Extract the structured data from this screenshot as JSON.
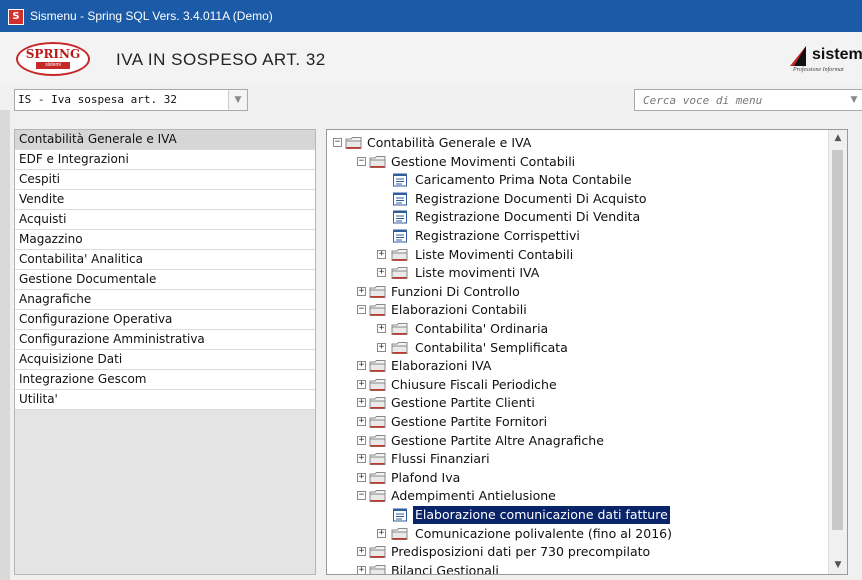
{
  "window": {
    "title": "Sismenu - Spring SQL Vers. 3.4.011A (Demo)",
    "icon_letter": "S"
  },
  "header": {
    "page_title": "IVA IN SOSPESO ART. 32",
    "spring_logo": {
      "text": "SPRING",
      "subtext": "sistemi"
    },
    "sistemi_logo": {
      "word": "sistem",
      "tagline": "Professione Informat"
    }
  },
  "menu_select": {
    "value": "IS - Iva sospesa art. 32"
  },
  "search": {
    "placeholder": "Cerca voce di menu"
  },
  "sidebar": {
    "items": [
      {
        "label": "Contabilità Generale e IVA",
        "active": true
      },
      {
        "label": "EDF e Integrazioni"
      },
      {
        "label": "Cespiti"
      },
      {
        "label": "Vendite"
      },
      {
        "label": "Acquisti"
      },
      {
        "label": "Magazzino"
      },
      {
        "label": "Contabilita' Analitica"
      },
      {
        "label": "Gestione Documentale"
      },
      {
        "label": "Anagrafiche"
      },
      {
        "label": "Configurazione Operativa"
      },
      {
        "label": "Configurazione Amministrativa"
      },
      {
        "label": "Acquisizione Dati"
      },
      {
        "label": "Integrazione Gescom"
      },
      {
        "label": "Utilita'"
      }
    ]
  },
  "tree": {
    "nodes": [
      {
        "label": "Contabilità Generale e IVA",
        "level": 0,
        "kind": "root",
        "exp": "−"
      },
      {
        "label": "Gestione Movimenti Contabili",
        "level": 1,
        "kind": "folder",
        "exp": "−"
      },
      {
        "label": "Caricamento Prima Nota Contabile",
        "level": 2,
        "kind": "doc"
      },
      {
        "label": "Registrazione Documenti Di Acquisto",
        "level": 2,
        "kind": "doc"
      },
      {
        "label": "Registrazione Documenti Di Vendita",
        "level": 2,
        "kind": "doc"
      },
      {
        "label": "Registrazione Corrispettivi",
        "level": 2,
        "kind": "doc"
      },
      {
        "label": "Liste Movimenti Contabili",
        "level": 2,
        "kind": "folder",
        "exp": "+"
      },
      {
        "label": "Liste movimenti IVA",
        "level": 2,
        "kind": "folder",
        "exp": "+"
      },
      {
        "label": "Funzioni Di Controllo",
        "level": 1,
        "kind": "folder",
        "exp": "+"
      },
      {
        "label": "Elaborazioni Contabili",
        "level": 1,
        "kind": "folder",
        "exp": "−"
      },
      {
        "label": "Contabilita' Ordinaria",
        "level": 2,
        "kind": "folder",
        "exp": "+"
      },
      {
        "label": "Contabilita' Semplificata",
        "level": 2,
        "kind": "folder",
        "exp": "+"
      },
      {
        "label": "Elaborazioni IVA",
        "level": 1,
        "kind": "folder",
        "exp": "+"
      },
      {
        "label": "Chiusure Fiscali Periodiche",
        "level": 1,
        "kind": "folder",
        "exp": "+"
      },
      {
        "label": "Gestione Partite Clienti",
        "level": 1,
        "kind": "folder",
        "exp": "+"
      },
      {
        "label": "Gestione Partite Fornitori",
        "level": 1,
        "kind": "folder",
        "exp": "+"
      },
      {
        "label": "Gestione Partite Altre Anagrafiche",
        "level": 1,
        "kind": "folder",
        "exp": "+"
      },
      {
        "label": "Flussi Finanziari",
        "level": 1,
        "kind": "folder",
        "exp": "+"
      },
      {
        "label": "Plafond Iva",
        "level": 1,
        "kind": "folder",
        "exp": "+"
      },
      {
        "label": "Adempimenti Antielusione",
        "level": 1,
        "kind": "folder",
        "exp": "−"
      },
      {
        "label": "Elaborazione comunicazione dati fatture",
        "level": 2,
        "kind": "doc",
        "selected": true
      },
      {
        "label": "Comunicazione polivalente (fino al 2016)",
        "level": 2,
        "kind": "folder",
        "exp": "+"
      },
      {
        "label": "Predisposizioni dati per 730 precompilato",
        "level": 1,
        "kind": "folder",
        "exp": "+"
      },
      {
        "label": "Bilanci Gestionali",
        "level": 1,
        "kind": "folder",
        "exp": "+"
      }
    ]
  },
  "colors": {
    "titlebar": "#1b5aa6",
    "selection": "#0a246a",
    "folder_red": "#c0392b",
    "doc_blue": "#2f5e9e"
  },
  "icons": {
    "expand": "plus-box-icon",
    "collapse": "minus-box-icon",
    "folder": "folder-icon",
    "document": "document-icon"
  }
}
